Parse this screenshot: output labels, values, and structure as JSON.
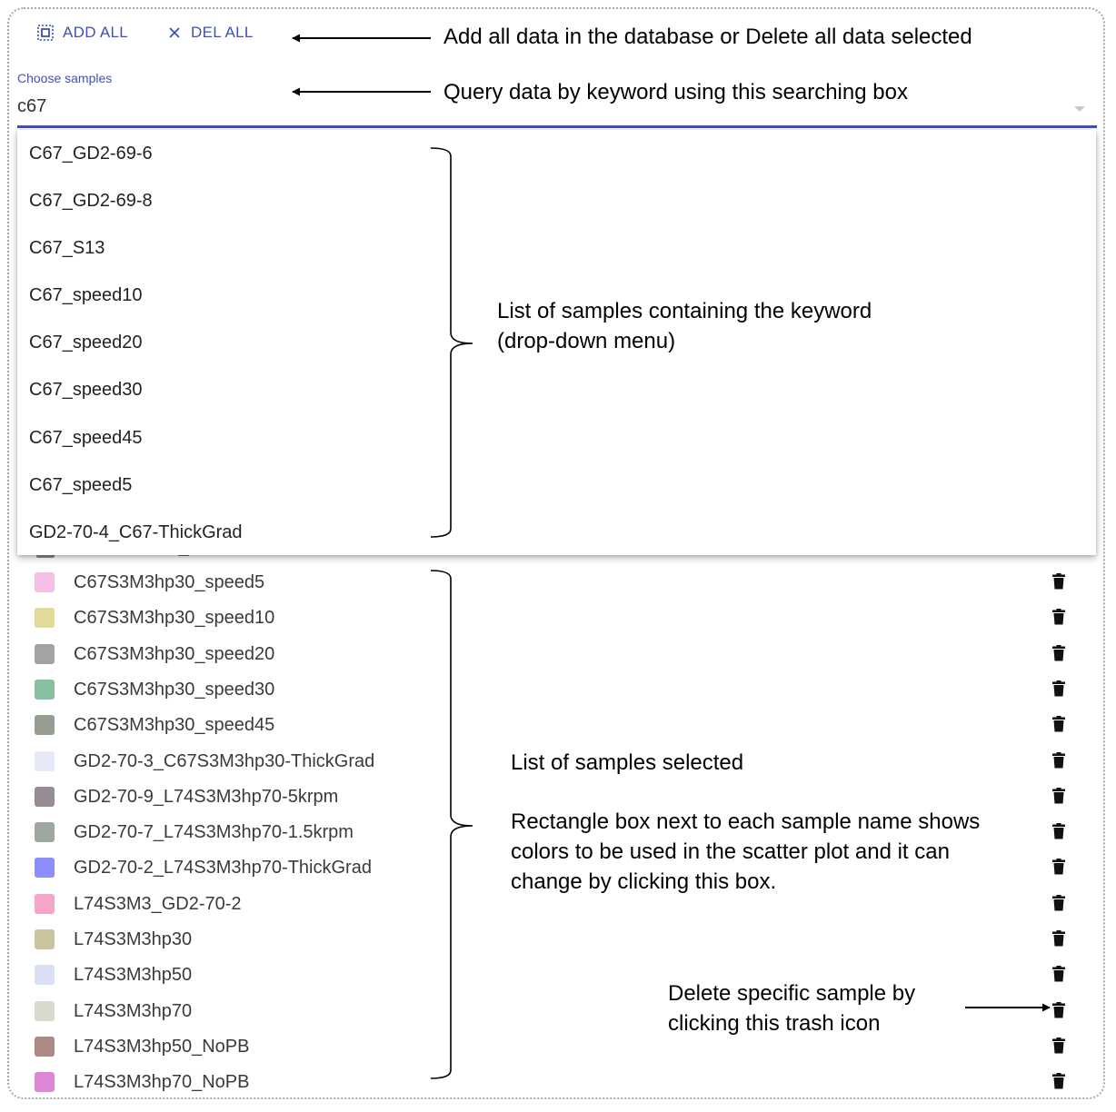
{
  "toolbar": {
    "add_all_label": "ADD ALL",
    "del_all_label": "DEL ALL",
    "accent_color": "#3f51b5"
  },
  "search": {
    "label": "Choose samples",
    "value": "c67"
  },
  "dropdown": {
    "items": [
      "C67_GD2-69-6",
      "C67_GD2-69-8",
      "C67_S13",
      "C67_speed10",
      "C67_speed20",
      "C67_speed30",
      "C67_speed45",
      "C67_speed5",
      "GD2-70-4_C67-ThickGrad"
    ]
  },
  "selected": {
    "items": [
      {
        "name": "C67S3M3hp30_speed5",
        "color": "#f3bfe4"
      },
      {
        "name": "C67S3M3hp30_speed10",
        "color": "#e2da98"
      },
      {
        "name": "C67S3M3hp30_speed20",
        "color": "#a3a3a3"
      },
      {
        "name": "C67S3M3hp30_speed30",
        "color": "#87bf9f"
      },
      {
        "name": "C67S3M3hp30_speed45",
        "color": "#969d91"
      },
      {
        "name": "GD2-70-3_C67S3M3hp30-ThickGrad",
        "color": "#e7e8f8"
      },
      {
        "name": "GD2-70-9_L74S3M3hp70-5krpm",
        "color": "#958c95"
      },
      {
        "name": "GD2-70-7_L74S3M3hp70-1.5krpm",
        "color": "#9fa8a0"
      },
      {
        "name": "GD2-70-2_L74S3M3hp70-ThickGrad",
        "color": "#8c8ffb"
      },
      {
        "name": "L74S3M3_GD2-70-2",
        "color": "#f4a5c8"
      },
      {
        "name": "L74S3M3hp30",
        "color": "#c9c39f"
      },
      {
        "name": "L74S3M3hp50",
        "color": "#dadff4"
      },
      {
        "name": "L74S3M3hp70",
        "color": "#d9d8cc"
      },
      {
        "name": "L74S3M3hp50_NoPB",
        "color": "#ad8a85"
      },
      {
        "name": "L74S3M3hp70_NoPB",
        "color": "#dc88d6"
      }
    ]
  },
  "annotations": {
    "add_del": "Add all data in the database or Delete all data selected",
    "query": "Query data by keyword using this searching box",
    "dropdown_line1": "List of samples containing the keyword",
    "dropdown_line2": "(drop-down menu)",
    "selected_title": "List of samples selected",
    "selected_line1": "Rectangle box next to each sample name shows",
    "selected_line2": "colors to be used in the scatter plot and it can",
    "selected_line3": "change by clicking this box.",
    "trash_line1": "Delete specific sample by",
    "trash_line2": "clicking this trash icon"
  }
}
